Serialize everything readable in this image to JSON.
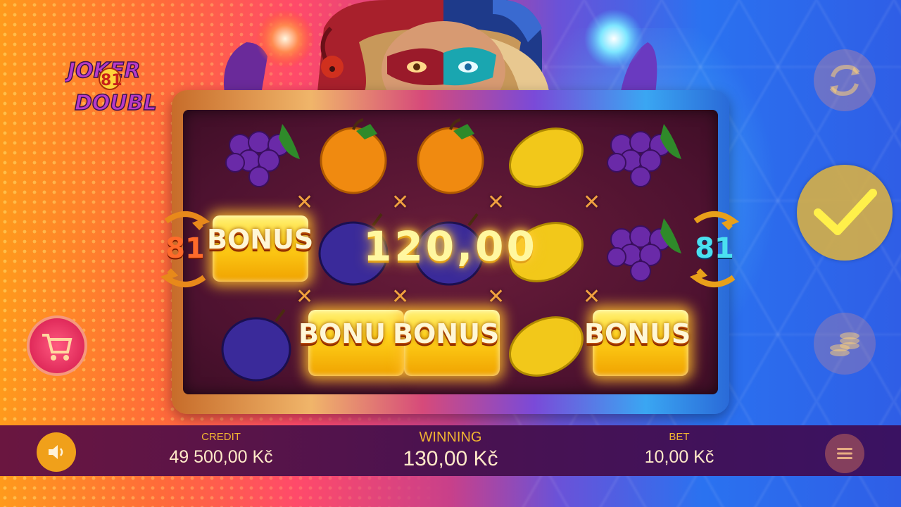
{
  "game": {
    "logo_line1": "JOKER",
    "logo_number": "81",
    "logo_line2": "DOUBLE"
  },
  "reels": {
    "win_amount": "120,00",
    "ways_left": "81",
    "ways_right": "81",
    "bonus_label": "BONUS",
    "bonus_label_cut": "BONU",
    "x_mark": "✕",
    "grid": [
      [
        "grapes",
        "orange",
        "orange",
        "lemon",
        "grapes"
      ],
      [
        "bonus",
        "plum",
        "plum",
        "lemon",
        "grapes"
      ],
      [
        "plum",
        "bonus",
        "bonus",
        "lemon",
        "bonus"
      ]
    ]
  },
  "controls": {
    "autoplay_icon": "autoplay-icon",
    "spin_icon": "check-icon",
    "coins_icon": "coins-icon",
    "shop_icon": "shopping-cart-icon",
    "sound_icon": "speaker-icon",
    "menu_icon": "hamburger-menu-icon"
  },
  "bottom_bar": {
    "credit_label": "CREDIT",
    "credit_value": "49 500,00 Kč",
    "winning_label": "WINNING",
    "winning_value": "130,00 Kč",
    "bet_label": "BET",
    "bet_value": "10,00 Kč"
  },
  "colors": {
    "accent_gold": "#f0b432",
    "spin_button": "#e1b43c",
    "bar_bg": "#4a1250"
  }
}
